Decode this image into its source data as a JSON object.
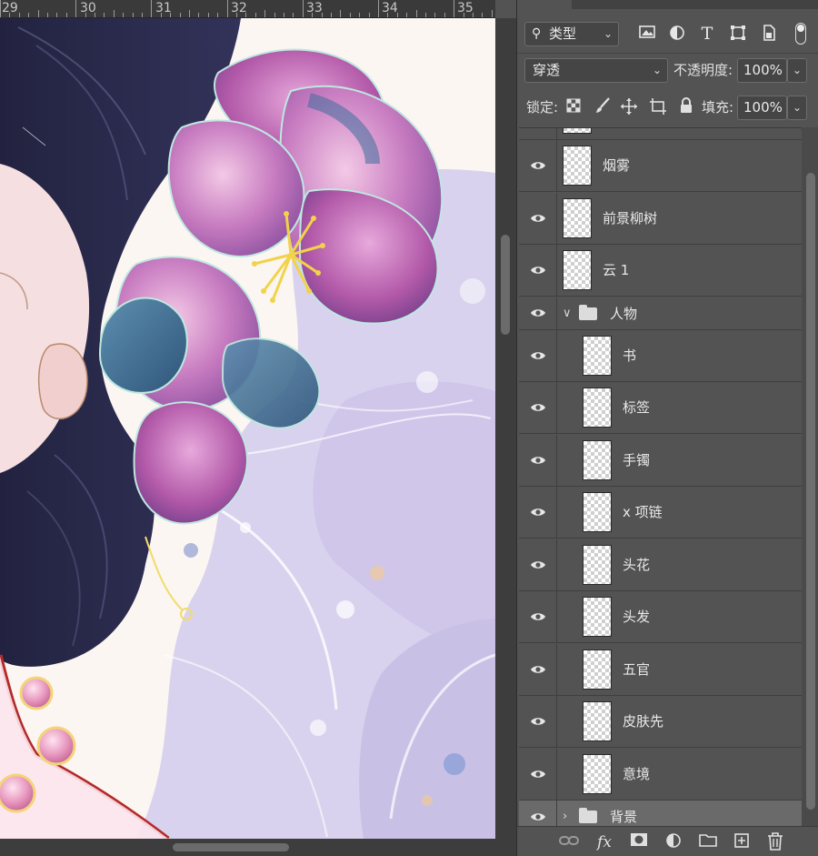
{
  "ruler": {
    "labels": [
      "29",
      "30",
      "31",
      "32",
      "33",
      "34",
      "35"
    ]
  },
  "filter": {
    "kind_label": "类型",
    "icons": [
      "search-icon",
      "image-filter-icon",
      "adjustment-filter-icon",
      "type-filter-icon",
      "shape-filter-icon",
      "smart-object-filter-icon",
      "filter-toggle-icon"
    ]
  },
  "blend": {
    "mode": "穿透",
    "opacity_label": "不透明度:",
    "opacity_value": "100%"
  },
  "lock": {
    "label": "锁定:",
    "fill_label": "填充:",
    "fill_value": "100%",
    "icons": [
      "lock-transparent-pixels-icon",
      "lock-image-pixels-icon",
      "lock-position-icon",
      "lock-artboard-icon",
      "lock-all-icon"
    ]
  },
  "layers": [
    {
      "name": "烟雾",
      "type": "layer",
      "visible": true,
      "indent": 0
    },
    {
      "name": "前景柳树",
      "type": "layer",
      "visible": true,
      "indent": 0
    },
    {
      "name": "云 1",
      "type": "layer",
      "visible": true,
      "indent": 0
    },
    {
      "name": "人物",
      "type": "group",
      "expanded": true,
      "visible": true,
      "indent": 0
    },
    {
      "name": "书",
      "type": "layer",
      "visible": true,
      "indent": 1
    },
    {
      "name": "标签",
      "type": "layer",
      "visible": true,
      "indent": 1
    },
    {
      "name": "手镯",
      "type": "layer",
      "visible": true,
      "indent": 1
    },
    {
      "name": "x 项链",
      "type": "layer",
      "visible": true,
      "indent": 1
    },
    {
      "name": "头花",
      "type": "layer",
      "visible": true,
      "indent": 1
    },
    {
      "name": "头发",
      "type": "layer",
      "visible": true,
      "indent": 1
    },
    {
      "name": "五官",
      "type": "layer",
      "visible": true,
      "indent": 1
    },
    {
      "name": "皮肤先",
      "type": "layer",
      "visible": true,
      "indent": 1
    },
    {
      "name": "意境",
      "type": "layer",
      "visible": true,
      "indent": 1
    },
    {
      "name": "背景",
      "type": "group",
      "expanded": false,
      "visible": true,
      "indent": 0,
      "selected": true
    }
  ],
  "bottom_icons": [
    "link-layers-icon",
    "layer-style-icon",
    "add-mask-icon",
    "adjustment-layer-icon",
    "new-group-icon",
    "new-layer-icon",
    "delete-layer-icon"
  ],
  "colors": {
    "panel_bg": "#535353",
    "selected_row": "#6a6a6a",
    "canvas_bg": "#fbf6f1"
  }
}
